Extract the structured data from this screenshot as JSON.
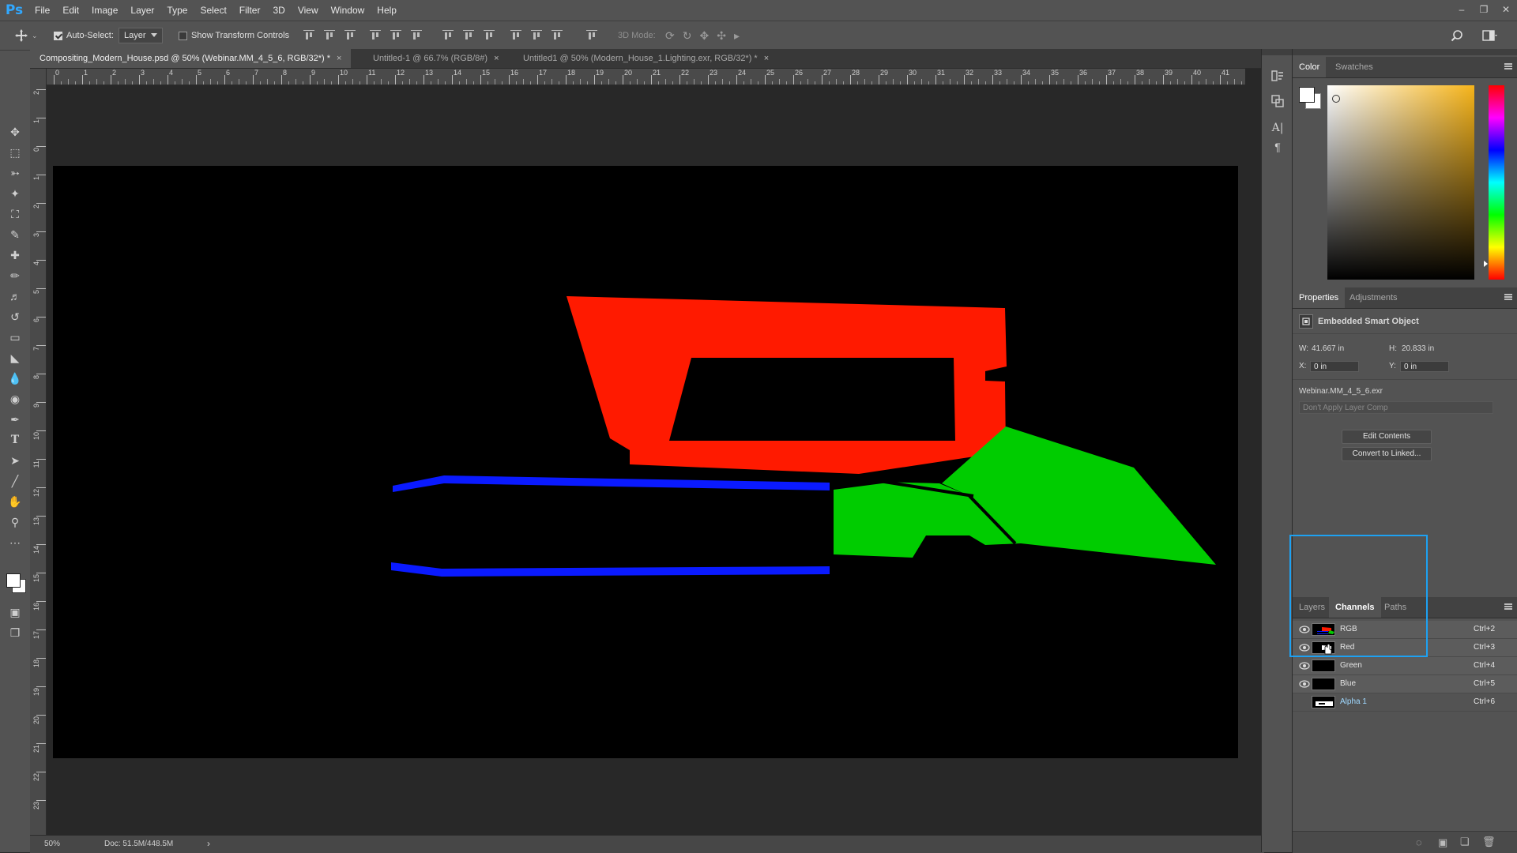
{
  "app": {
    "logo": "Ps"
  },
  "menu": [
    "File",
    "Edit",
    "Image",
    "Layer",
    "Type",
    "Select",
    "Filter",
    "3D",
    "View",
    "Window",
    "Help"
  ],
  "options": {
    "auto_select_label": "Auto-Select:",
    "auto_select_checked": true,
    "auto_select_target": "Layer",
    "show_transform_label": "Show Transform Controls",
    "show_transform_checked": false,
    "mode_3d_label": "3D Mode:"
  },
  "tabs": [
    {
      "label": "Compositing_Modern_House.psd @ 50% (Webinar.MM_4_5_6, RGB/32*) *",
      "close": "×",
      "active": true
    },
    {
      "label": "Untitled-1 @ 66.7% (RGB/8#)",
      "close": "×",
      "active": false
    },
    {
      "label": "Untitled1 @ 50% (Modern_House_1.Lighting.exr, RGB/32*) *",
      "close": "×",
      "active": false
    }
  ],
  "ruler_top": [
    "0",
    "1",
    "2",
    "3",
    "4",
    "5",
    "6",
    "7",
    "8",
    "9",
    "10",
    "11",
    "12",
    "13",
    "14",
    "15",
    "16",
    "17",
    "18",
    "19",
    "20",
    "21",
    "22",
    "23",
    "24",
    "25",
    "26",
    "27",
    "28",
    "29",
    "30",
    "31",
    "32",
    "33",
    "34",
    "35",
    "36",
    "37",
    "38",
    "39",
    "40",
    "41"
  ],
  "ruler_left": [
    "2",
    "1",
    "0",
    "1",
    "2",
    "3",
    "4",
    "5",
    "6",
    "7",
    "8",
    "9",
    "10",
    "11",
    "12",
    "13",
    "14",
    "15",
    "16",
    "17",
    "18",
    "19",
    "20",
    "21",
    "22",
    "23"
  ],
  "status": {
    "zoom": "50%",
    "doc": "Doc: 51.5M/448.5M",
    "arrow": "›"
  },
  "color_panel": {
    "tabs": [
      "Color",
      "Swatches"
    ],
    "active": "Color"
  },
  "properties_panel": {
    "tabs": [
      "Properties",
      "Adjustments"
    ],
    "active": "Properties",
    "type": "Embedded Smart Object",
    "w_label": "W:",
    "w_value": "41.667 in",
    "h_label": "H:",
    "h_value": "20.833 in",
    "x_label": "X:",
    "x_value": "0 in",
    "y_label": "Y:",
    "y_value": "0 in",
    "file": "Webinar.MM_4_5_6.exr",
    "layer_comp": "Don't Apply Layer Comp",
    "edit_contents": "Edit Contents",
    "convert": "Convert to Linked..."
  },
  "channels_panel": {
    "tabs": [
      "Layers",
      "Channels",
      "Paths"
    ],
    "active": "Channels",
    "rows": [
      {
        "name": "RGB",
        "shortcut": "Ctrl+2"
      },
      {
        "name": "Red",
        "shortcut": "Ctrl+3"
      },
      {
        "name": "Green",
        "shortcut": "Ctrl+4"
      },
      {
        "name": "Blue",
        "shortcut": "Ctrl+5"
      },
      {
        "name": "Alpha 1",
        "shortcut": "Ctrl+6"
      }
    ]
  },
  "colors": {
    "red_shape": "#ff1a00",
    "green_shape": "#00cc00",
    "blue_shape": "#0a1aff",
    "highlight": "#1da1f2",
    "ui_bg": "#535353"
  },
  "icons": [
    "move-icon",
    "marquee-icon",
    "lasso-icon",
    "magic-wand-icon",
    "crop-icon",
    "eyedropper-icon",
    "healing-icon",
    "brush-icon",
    "stamp-icon",
    "history-brush-icon",
    "eraser-icon",
    "bucket-icon",
    "blur-icon",
    "dodge-icon",
    "pen-icon",
    "type-icon",
    "path-select-icon",
    "line-icon",
    "hand-icon",
    "zoom-icon",
    "more-icon",
    "search-icon",
    "workspace-icon"
  ]
}
